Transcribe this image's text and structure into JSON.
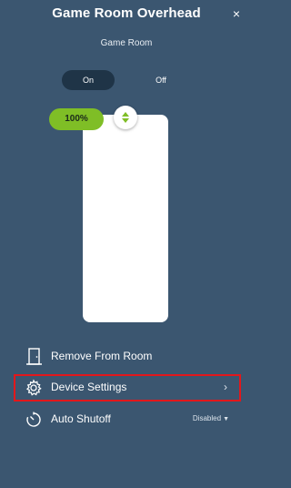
{
  "header": {
    "title": "Game Room Overhead",
    "close_glyph": "×",
    "room": "Game Room"
  },
  "power_toggle": {
    "on_label": "On",
    "off_label": "Off",
    "selected": "On"
  },
  "dimmer": {
    "level_label": "100%",
    "level_fraction": 1.0
  },
  "menu": {
    "remove": {
      "label": "Remove From Room",
      "icon": "door-icon"
    },
    "settings": {
      "label": "Device Settings",
      "icon": "gear-icon",
      "chevron": "›"
    },
    "shutoff": {
      "label": "Auto Shutoff",
      "icon": "timer-icon",
      "value": "Disabled",
      "caret": "▼"
    }
  },
  "colors": {
    "background": "#3b5670",
    "toggle_selected": "#1f3447",
    "level_badge": "#7fbe26",
    "highlight": "#e3171b"
  }
}
